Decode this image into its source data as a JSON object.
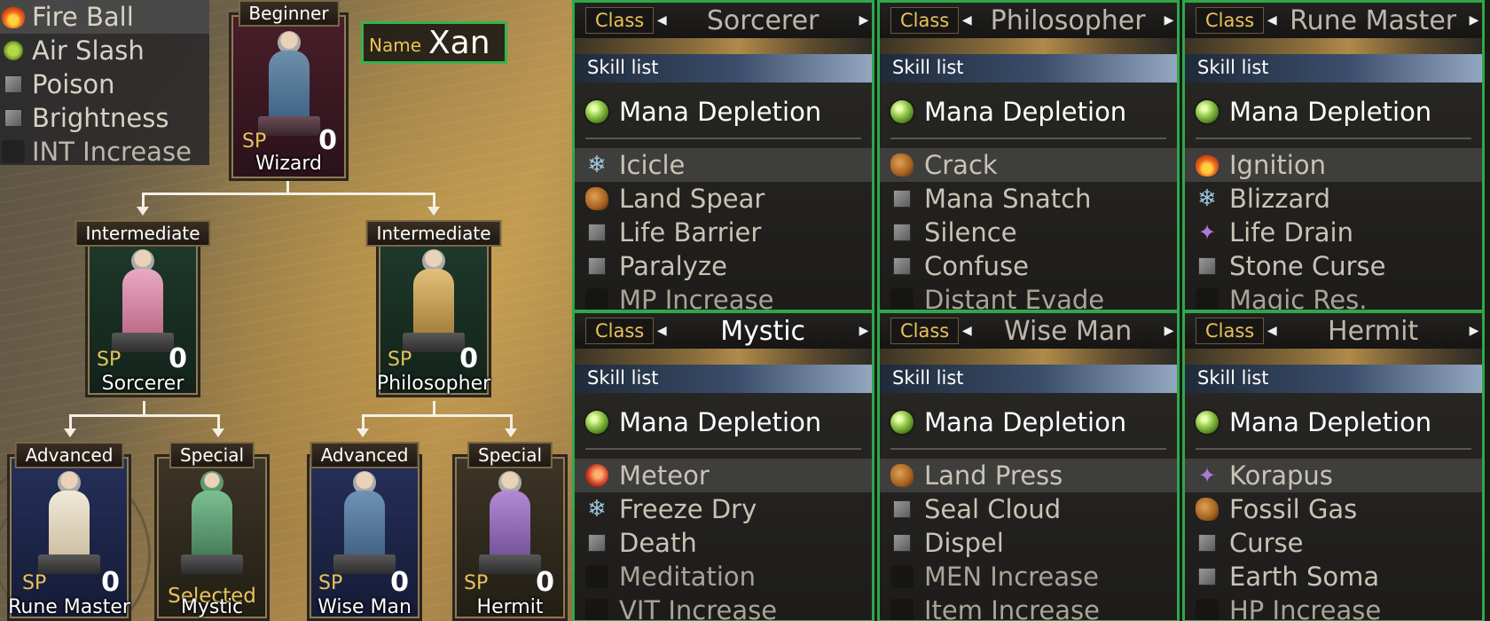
{
  "character": {
    "name_label": "Name",
    "name": "Xan"
  },
  "skill_popup": [
    {
      "label": "Fire Ball",
      "icon": "fire-icon"
    },
    {
      "label": "Air Slash",
      "icon": "wind-icon"
    },
    {
      "label": "Poison",
      "icon": "cube-icon"
    },
    {
      "label": "Brightness",
      "icon": "cube-icon"
    },
    {
      "label": "INT Increase",
      "icon": "empty-icon"
    }
  ],
  "tree": {
    "sp_label": "SP",
    "selected_label": "Selected",
    "nodes": {
      "wizard": {
        "tier": "Beginner",
        "class": "Wizard",
        "sp": "0"
      },
      "sorcerer": {
        "tier": "Intermediate",
        "class": "Sorcerer",
        "sp": "0"
      },
      "philosopher": {
        "tier": "Intermediate",
        "class": "Philosopher",
        "sp": "0"
      },
      "rune_master": {
        "tier": "Advanced",
        "class": "Rune Master",
        "sp": "0"
      },
      "mystic": {
        "tier": "Special",
        "class": "Mystic"
      },
      "wise_man": {
        "tier": "Advanced",
        "class": "Wise Man",
        "sp": "0"
      },
      "hermit": {
        "tier": "Special",
        "class": "Hermit",
        "sp": "0"
      }
    }
  },
  "panel_labels": {
    "class": "Class",
    "skill_list": "Skill list"
  },
  "panels": [
    {
      "class": "Sorcerer",
      "main_skill": "Mana Depletion",
      "skills": [
        {
          "label": "Icicle",
          "icon": "ice-icon"
        },
        {
          "label": "Land Spear",
          "icon": "rock-icon"
        },
        {
          "label": "Life Barrier",
          "icon": "cube-icon"
        },
        {
          "label": "Paralyze",
          "icon": "cube-icon"
        },
        {
          "label": "MP Increase",
          "icon": "empty-icon"
        }
      ]
    },
    {
      "class": "Philosopher",
      "main_skill": "Mana Depletion",
      "skills": [
        {
          "label": "Crack",
          "icon": "rock-icon"
        },
        {
          "label": "Mana Snatch",
          "icon": "cube-icon"
        },
        {
          "label": "Silence",
          "icon": "cube-icon"
        },
        {
          "label": "Confuse",
          "icon": "cube-icon"
        },
        {
          "label": "Distant Evade",
          "icon": "empty-icon"
        }
      ]
    },
    {
      "class": "Rune Master",
      "main_skill": "Mana Depletion",
      "skills": [
        {
          "label": "Ignition",
          "icon": "fire-icon"
        },
        {
          "label": "Blizzard",
          "icon": "ice-icon"
        },
        {
          "label": "Life Drain",
          "icon": "drain-icon"
        },
        {
          "label": "Stone Curse",
          "icon": "cube-icon"
        },
        {
          "label": "Magic Res.",
          "icon": "empty-icon"
        }
      ]
    },
    {
      "class": "Mystic",
      "main_skill": "Mana Depletion",
      "skills": [
        {
          "label": "Meteor",
          "icon": "meteor-icon"
        },
        {
          "label": "Freeze Dry",
          "icon": "ice-icon"
        },
        {
          "label": "Death",
          "icon": "cube-icon"
        },
        {
          "label": "Meditation",
          "icon": "empty-icon"
        },
        {
          "label": "VIT Increase",
          "icon": "empty-icon"
        }
      ]
    },
    {
      "class": "Wise Man",
      "main_skill": "Mana Depletion",
      "skills": [
        {
          "label": "Land Press",
          "icon": "rock-icon"
        },
        {
          "label": "Seal Cloud",
          "icon": "cube-icon"
        },
        {
          "label": "Dispel",
          "icon": "cube-icon"
        },
        {
          "label": "MEN Increase",
          "icon": "empty-icon"
        },
        {
          "label": "Item Increase",
          "icon": "empty-icon"
        }
      ]
    },
    {
      "class": "Hermit",
      "main_skill": "Mana Depletion",
      "skills": [
        {
          "label": "Korapus",
          "icon": "drain-icon"
        },
        {
          "label": "Fossil Gas",
          "icon": "rock-icon"
        },
        {
          "label": "Curse",
          "icon": "cube-icon"
        },
        {
          "label": "Earth Soma",
          "icon": "cube-icon"
        },
        {
          "label": "HP Increase",
          "icon": "empty-icon"
        }
      ]
    }
  ],
  "colors": {
    "highlight_border": "#2fa849",
    "gold_label": "#e8c35a"
  }
}
